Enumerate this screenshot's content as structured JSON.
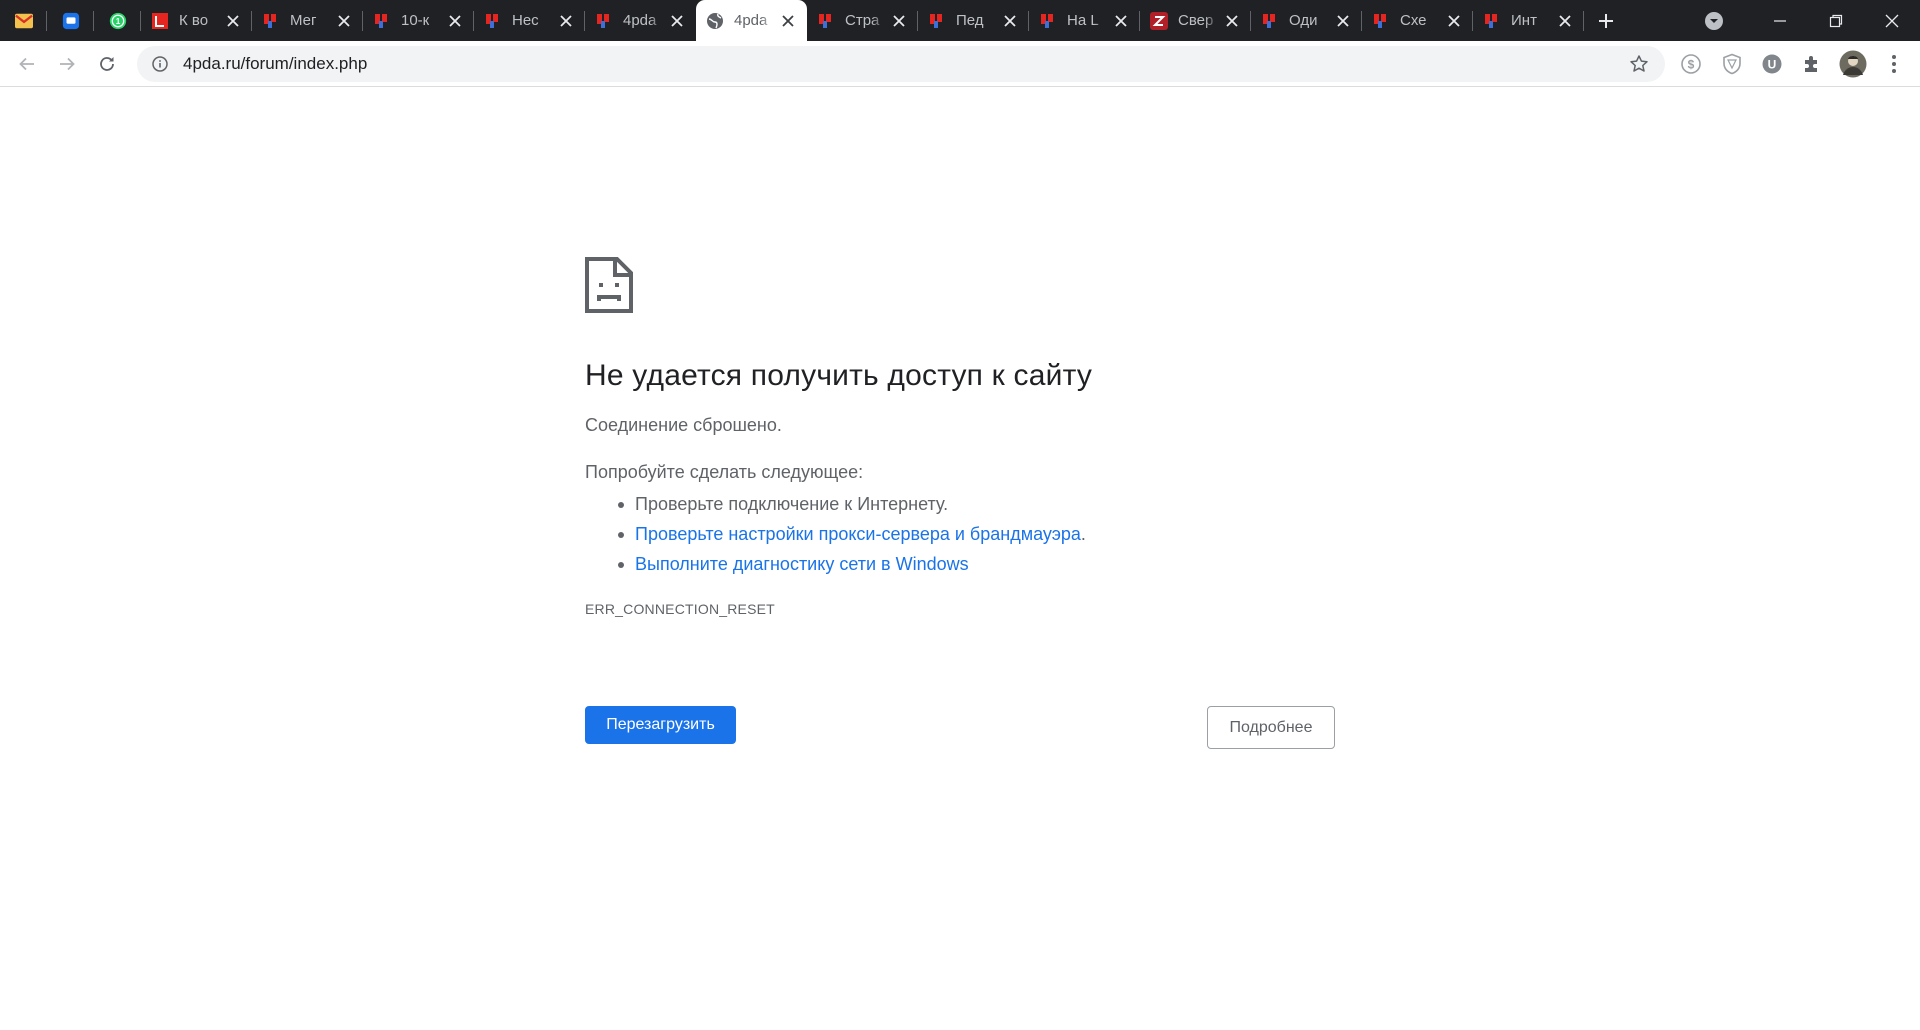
{
  "browser": {
    "tabs": [
      {
        "title": "",
        "icon": "gmail-icon",
        "pinned": true
      },
      {
        "title": "",
        "icon": "chat-icon",
        "pinned": true
      },
      {
        "title": "",
        "icon": "whatsapp-icon",
        "pinned": true,
        "badge": "1"
      },
      {
        "title": "К во",
        "icon": "red-square-icon"
      },
      {
        "title": "Мег",
        "icon": "yandex-icon"
      },
      {
        "title": "10-к",
        "icon": "yandex-icon"
      },
      {
        "title": "Нес",
        "icon": "yandex-icon"
      },
      {
        "title": "4pda",
        "icon": "yandex-icon"
      },
      {
        "title": "4pda",
        "icon": "globe-icon",
        "active": true
      },
      {
        "title": "Стра",
        "icon": "yandex-icon"
      },
      {
        "title": "Пед",
        "icon": "yandex-icon"
      },
      {
        "title": "На L",
        "icon": "yandex-icon"
      },
      {
        "title": "Свер",
        "icon": "zen-z-icon"
      },
      {
        "title": "Оди",
        "icon": "yandex-icon"
      },
      {
        "title": "Схе",
        "icon": "yandex-icon"
      },
      {
        "title": "Инт",
        "icon": "yandex-icon"
      }
    ],
    "url": "4pda.ru/forum/index.php"
  },
  "error": {
    "title": "Не удается получить доступ к сайту",
    "subtitle": "Соединение сброшено.",
    "try_heading": "Попробуйте сделать следующее:",
    "suggestion_1": "Проверьте подключение к Интернету.",
    "suggestion_2": "Проверьте настройки прокси-сервера и брандмауэра",
    "suggestion_2_tail": ".",
    "suggestion_3": "Выполните диагностику сети в Windows",
    "code": "ERR_CONNECTION_RESET",
    "reload_label": "Перезагрузить",
    "details_label": "Подробнее"
  },
  "colors": {
    "accent": "#1a73e8",
    "tabstrip": "#202124",
    "yandex_red": "#e52620"
  }
}
